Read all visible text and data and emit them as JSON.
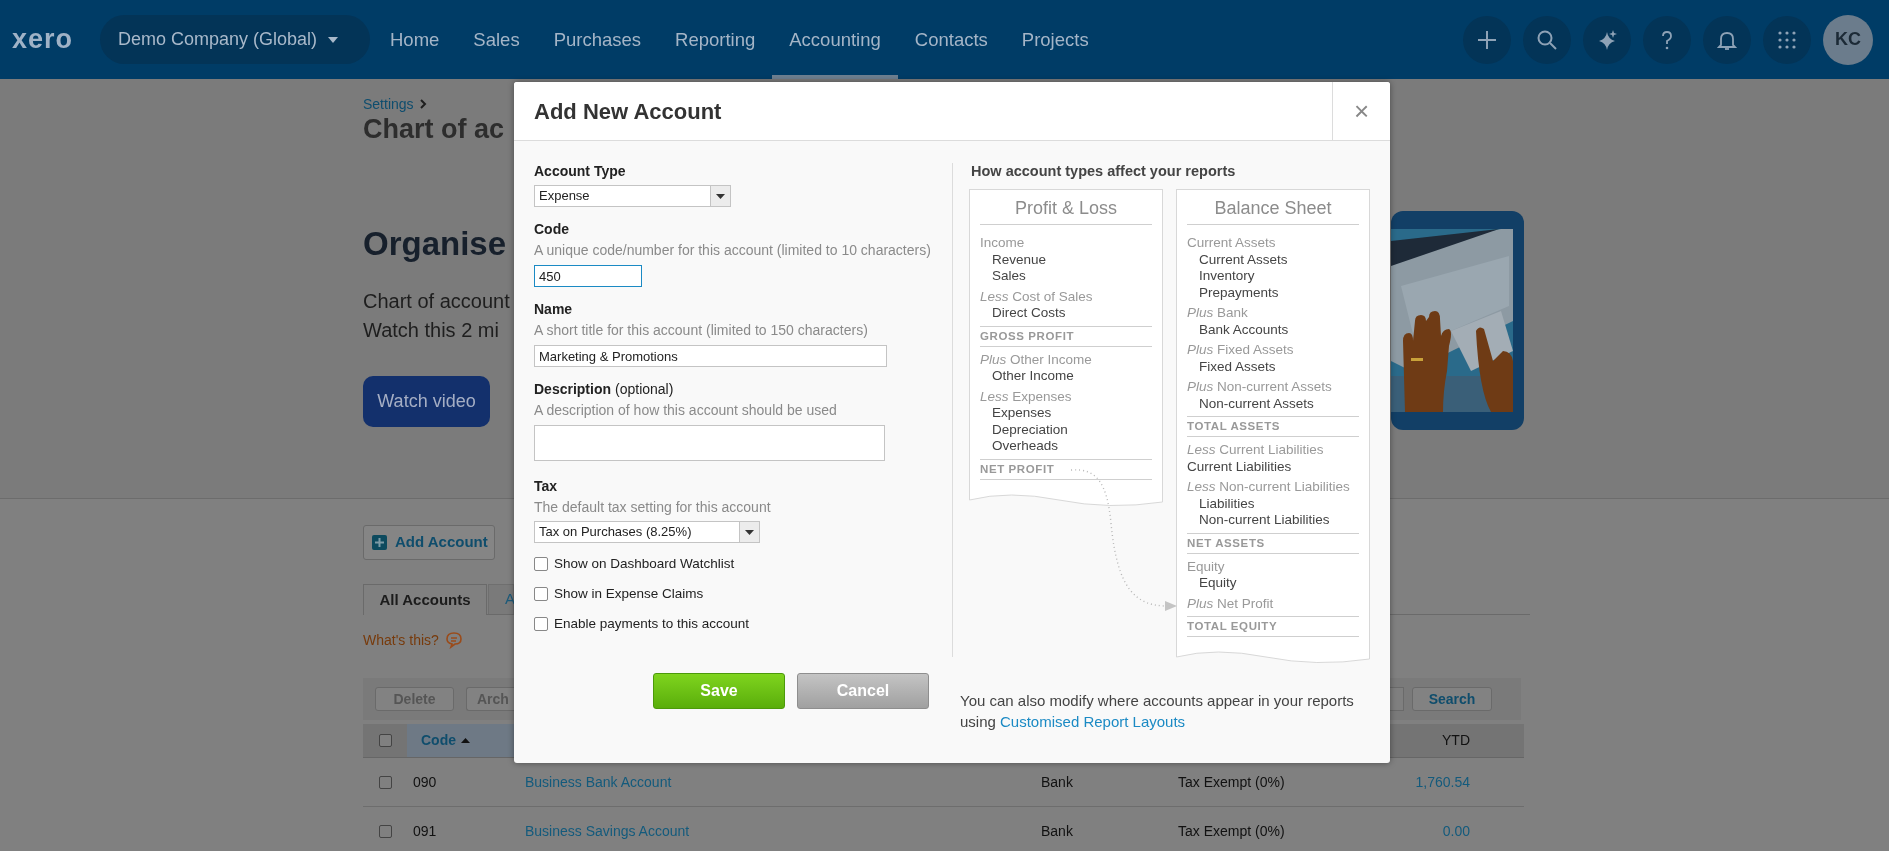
{
  "top_nav": {
    "logo": "xero",
    "organisation": "Demo Company (Global)",
    "items": [
      {
        "label": "Home",
        "selected": false
      },
      {
        "label": "Sales",
        "selected": false
      },
      {
        "label": "Purchases",
        "selected": false
      },
      {
        "label": "Reporting",
        "selected": false
      },
      {
        "label": "Accounting",
        "selected": true
      },
      {
        "label": "Contacts",
        "selected": false
      },
      {
        "label": "Projects",
        "selected": false
      }
    ],
    "tools": [
      {
        "kind": "add"
      },
      {
        "kind": "search"
      },
      {
        "kind": "sparkle"
      },
      {
        "kind": "help"
      },
      {
        "kind": "notifications"
      },
      {
        "kind": "apps"
      }
    ],
    "avatar": "KC"
  },
  "page": {
    "breadcrumb": "Settings",
    "title": "Chart of ac",
    "banner": {
      "heading": "Organise",
      "lines": [
        "Chart of account",
        "Watch this 2 mi"
      ],
      "button": "Watch video"
    },
    "add_button": "Add Account",
    "tabs": [
      {
        "label": "All Accounts",
        "selected": true
      },
      {
        "label": "A",
        "selected": false
      }
    ],
    "help_link": "What's this?",
    "toolbar": {
      "buttons": [
        "Delete",
        "Arch"
      ],
      "search_button": "Search"
    },
    "table": {
      "header_checked": false,
      "columns": [
        {
          "label": "Code",
          "sorted": true
        },
        {
          "label": "YTD",
          "sorted": false
        }
      ],
      "rows": [
        {
          "checked": false,
          "code": "090",
          "name": "Business Bank Account",
          "type": "Bank",
          "tax": "Tax Exempt (0%)",
          "ytd": "1,760.54"
        },
        {
          "checked": false,
          "code": "091",
          "name": "Business Savings Account",
          "type": "Bank",
          "tax": "Tax Exempt (0%)",
          "ytd": "0.00"
        }
      ]
    }
  },
  "dialog": {
    "title": "Add New Account",
    "close": "×",
    "fields": [
      {
        "kind": "select",
        "label": "Account Type",
        "value": "Expense"
      },
      {
        "kind": "text",
        "label": "Code",
        "help": "A unique code/number for this account (limited to 10 characters)",
        "value": "450",
        "focused": true
      },
      {
        "kind": "text",
        "label": "Name",
        "help": "A short title for this account (limited to 150 characters)",
        "value": "Marketing & Promotions",
        "focused": false
      },
      {
        "kind": "textarea",
        "label": "Description",
        "label_note": "(optional)",
        "help": "A description of how this account should be used"
      },
      {
        "kind": "select",
        "label": "Tax",
        "help": "The default tax setting for this account",
        "value": "Tax on Purchases (8.25%)"
      }
    ],
    "checkboxes": [
      {
        "label": "Show on Dashboard Watchlist",
        "checked": false
      },
      {
        "label": "Show in Expense Claims",
        "checked": false
      },
      {
        "label": "Enable payments to this account",
        "checked": false
      }
    ],
    "buttons": [
      {
        "label": "Save",
        "kind": "primary"
      },
      {
        "label": "Cancel",
        "kind": "secondary"
      }
    ],
    "guide": {
      "title": "How account types affect your reports",
      "reports": [
        {
          "title": "Profit & Loss",
          "lines": [
            {
              "kind": "heading",
              "text": "Income"
            },
            {
              "kind": "item",
              "text": "Revenue"
            },
            {
              "kind": "item",
              "text": "Sales"
            },
            {
              "kind": "heading",
              "text": "*Less* Cost of Sales"
            },
            {
              "kind": "item",
              "text": "Direct Costs"
            },
            {
              "kind": "total",
              "text": "GROSS PROFIT"
            },
            {
              "kind": "heading",
              "text": "*Plus* Other Income"
            },
            {
              "kind": "item",
              "text": "Other Income"
            },
            {
              "kind": "heading",
              "text": "*Less* Expenses"
            },
            {
              "kind": "item",
              "text": "Expenses"
            },
            {
              "kind": "item",
              "text": "Depreciation"
            },
            {
              "kind": "item",
              "text": "Overheads"
            },
            {
              "kind": "total",
              "text": "NET PROFIT"
            }
          ]
        },
        {
          "title": "Balance Sheet",
          "lines": [
            {
              "kind": "heading",
              "text": "Current Assets"
            },
            {
              "kind": "item",
              "text": "Current Assets"
            },
            {
              "kind": "item",
              "text": "Inventory"
            },
            {
              "kind": "item",
              "text": "Prepayments"
            },
            {
              "kind": "heading",
              "text": "*Plus* Bank"
            },
            {
              "kind": "item",
              "text": "Bank Accounts"
            },
            {
              "kind": "heading",
              "text": "*Plus* Fixed Assets"
            },
            {
              "kind": "item",
              "text": "Fixed Assets"
            },
            {
              "kind": "heading",
              "text": "*Plus* Non-current Assets"
            },
            {
              "kind": "item",
              "text": "Non-current Assets"
            },
            {
              "kind": "total",
              "text": "TOTAL ASSETS"
            },
            {
              "kind": "heading",
              "text": "*Less* Current Liabilities"
            },
            {
              "kind": "item_flush",
              "text": "Current Liabilities"
            },
            {
              "kind": "heading",
              "text": "*Less* Non-current Liabilities"
            },
            {
              "kind": "item",
              "text": "Liabilities"
            },
            {
              "kind": "item",
              "text": "Non-current Liabilities"
            },
            {
              "kind": "total",
              "text": "NET ASSETS"
            },
            {
              "kind": "heading",
              "text": "Equity"
            },
            {
              "kind": "item",
              "text": "Equity"
            },
            {
              "kind": "heading",
              "text": "*Plus* Net Profit"
            },
            {
              "kind": "total",
              "text": "TOTAL EQUITY"
            }
          ]
        }
      ]
    },
    "note": {
      "text": "You can also modify where accounts appear in your reports",
      "link_prefix": "using",
      "link": "Customised Report Layouts"
    }
  }
}
